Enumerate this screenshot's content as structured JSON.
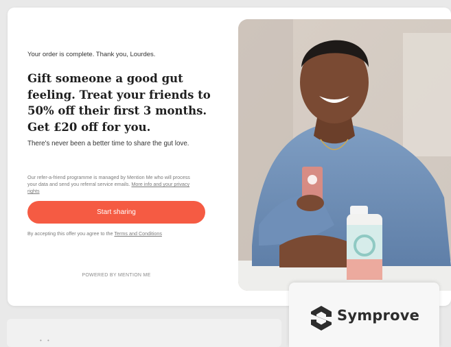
{
  "order_line": "Your order is complete. Thank you, Lourdes.",
  "headline": "Gift someone a good gut feeling. Treat your friends to 50% off their first 3 months. Get £20 off for you.",
  "subtitle": "There's never been a better time to share the gut love.",
  "privacy": {
    "text": "Our refer-a-friend programme is managed by Mention Me who will process your data and send you referral service emails.",
    "link": "More info and your privacy rights"
  },
  "cta_label": "Start sharing",
  "terms": {
    "prefix": "By accepting this offer you agree to the",
    "link": "Terms and Conditions"
  },
  "powered_by": "POWERED BY MENTION ME",
  "brand": {
    "name": "Symprove",
    "accent": "#f55b43"
  }
}
